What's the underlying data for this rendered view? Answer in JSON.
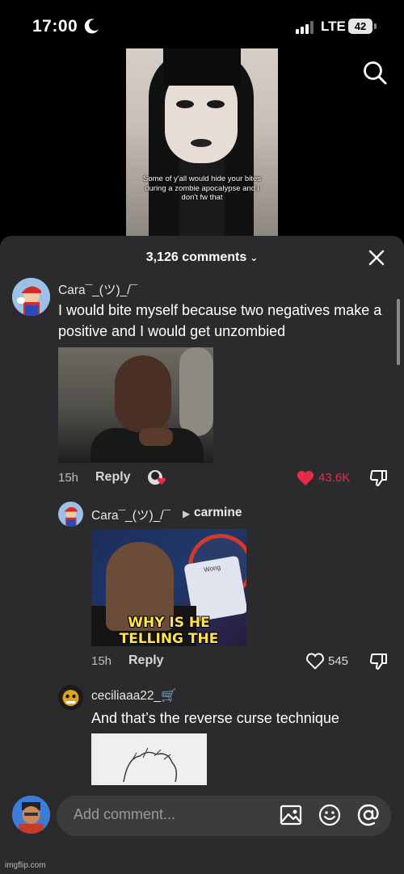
{
  "status_bar": {
    "time": "17:00",
    "network": "LTE",
    "battery": "42"
  },
  "video": {
    "caption": "Some of y'all would hide your bites during a zombie apocalypse and i don't fw that"
  },
  "comments_sheet": {
    "title": "3,126 comments",
    "comments": [
      {
        "username": "Cara¯_(ツ)_/¯",
        "text": "I would bite myself because two negatives make a positive and I would get unzombied",
        "time": "15h",
        "reply_label": "Reply",
        "likes": "43.6K",
        "liked": true
      }
    ],
    "replies": [
      {
        "username": "Cara¯_(ツ)_/¯",
        "reply_to": "carmine",
        "image_text_line1": "WHY IS HE",
        "image_text_line2": "TELLING THE TRUTH?",
        "image_label": "Wong",
        "time": "15h",
        "reply_label": "Reply",
        "likes": "545"
      },
      {
        "username": "ceciliaaa22_🛒",
        "text": "And that’s the reverse curse technique"
      }
    ]
  },
  "composer": {
    "placeholder": "Add comment..."
  },
  "watermark": "imgflip.com",
  "colors": {
    "sheet_bg": "#2b2b2d",
    "like_red": "#e8294b",
    "composer_bg": "#3c3c3e"
  }
}
